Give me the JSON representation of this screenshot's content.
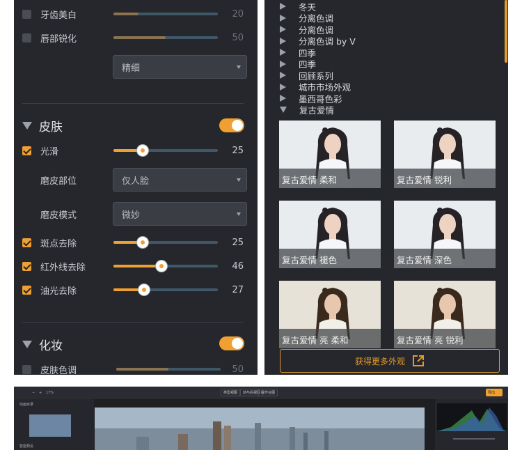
{
  "left_panel": {
    "top_rows": [
      {
        "label": "牙齿美白",
        "value": "20",
        "checked": false,
        "fraction": 0.24
      },
      {
        "label": "唇部锐化",
        "value": "50",
        "checked": false,
        "fraction": 0.5
      }
    ],
    "select_fine": "精细",
    "skin": {
      "title": "皮肤",
      "toggle_on": true,
      "smooth": {
        "label": "光滑",
        "value": "25",
        "checked": true,
        "fraction": 0.28
      },
      "area": {
        "label": "磨皮部位",
        "value": "仅人脸"
      },
      "mode": {
        "label": "磨皮模式",
        "value": "微妙"
      },
      "sliders": [
        {
          "label": "斑点去除",
          "value": "25",
          "checked": true,
          "fraction": 0.28
        },
        {
          "label": "红外线去除",
          "value": "46",
          "checked": true,
          "fraction": 0.46
        },
        {
          "label": "油光去除",
          "value": "27",
          "checked": true,
          "fraction": 0.29
        }
      ]
    },
    "makeup": {
      "title": "化妆",
      "toggle_on": true,
      "skin_tone": {
        "label": "皮肤色调",
        "value": "50",
        "checked": false,
        "fraction": 0.5
      }
    }
  },
  "right_panel": {
    "presets": [
      "冬天",
      "分离色调",
      "分离色调",
      "分离色调 by V",
      "四季",
      "四季",
      "回顾系列",
      "城市市场外观",
      "墨西哥色彩",
      "复古爱情"
    ],
    "expanded_index": 9,
    "thumbnails": [
      {
        "caption": "复古爱情 柔和",
        "tone": "cool"
      },
      {
        "caption": "复古爱情 锐利",
        "tone": "cool"
      },
      {
        "caption": "复古爱情 褪色",
        "tone": "cool"
      },
      {
        "caption": "复古爱情 深色",
        "tone": "cool"
      },
      {
        "caption": "复古爱情 亮 柔和",
        "tone": "warm"
      },
      {
        "caption": "复古爱情 亮 锐利",
        "tone": "warm"
      }
    ],
    "more_button": "获得更多外观",
    "accent": "#e39a2c"
  },
  "bottom_panel": {
    "zoom": "17%",
    "view_buttons": [
      "类型视图",
      "前与后视图",
      "操作台图"
    ],
    "export_label": "导出",
    "side_title": "动画目录",
    "side_title2": "智能预设"
  },
  "colors": {
    "panel_bg": "#25272c",
    "accent": "#f0a030",
    "track": "#3f5867"
  },
  "icons": [
    "chevron-right-icon",
    "chevron-down-icon",
    "external-link-icon",
    "checkbox-icon",
    "toggle-icon"
  ]
}
